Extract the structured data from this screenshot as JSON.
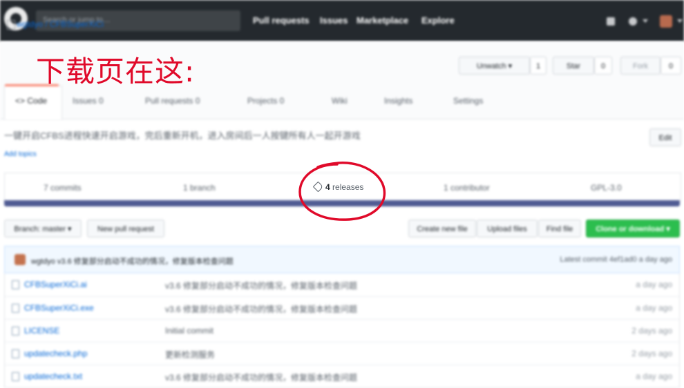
{
  "header": {
    "search_placeholder": "Search or jump to…",
    "nav": [
      "Pull requests",
      "Issues",
      "Marketplace",
      "Explore"
    ]
  },
  "repo": {
    "owner_name": "wgtdyo / CFBSuperXiCi",
    "unwatch_label": "Unwatch ▾",
    "watch_count": "1",
    "star_label": "Star",
    "star_count": "0",
    "fork_label": "Fork",
    "fork_count": "0"
  },
  "annotation": {
    "text": "下载页在这:",
    "color": "#e00a2a"
  },
  "tabs": {
    "code": "<> Code",
    "issues": "Issues 0",
    "pull_requests": "Pull requests 0",
    "projects": "Projects 0",
    "wiki": "Wiki",
    "insights": "Insights",
    "settings": "Settings"
  },
  "description": {
    "text": "一键开启CFBS进程快速开启游戏，完后重新开机，进入房间后一人按键所有人一起开游戏",
    "link": "Add topics",
    "edit_label": "Edit"
  },
  "numbers": {
    "commits": "7 commits",
    "branch": "1 branch",
    "releases_count": "4",
    "releases_word": "releases",
    "contributors": "1 contributor",
    "license": "GPL-3.0"
  },
  "file_nav": {
    "branch": "Branch: master ▾",
    "new_pr": "New pull request",
    "create": "Create new file",
    "upload": "Upload files",
    "find": "Find file",
    "clone": "Clone or download ▾"
  },
  "commit": {
    "author_message": "wgtdyo  v3.6 修复部分启动不成功的情况，修复版本检查问题",
    "latest": "Latest commit 4ef1ad0 a day ago"
  },
  "files": [
    {
      "name": "CFBSuperXiCi.ai",
      "message": "v3.6 修复部分启动不成功的情况，修复版本检查问题",
      "age": "a day ago"
    },
    {
      "name": "CFBSuperXiCi.exe",
      "message": "v3.6 修复部分启动不成功的情况，修复版本检查问题",
      "age": "a day ago"
    },
    {
      "name": "LICENSE",
      "message": "Initial commit",
      "age": "2 days ago"
    },
    {
      "name": "updatecheck.php",
      "message": "更新检测服务",
      "age": "2 days ago"
    },
    {
      "name": "updatecheck.txt",
      "message": "v3.6 修复部分启动不成功的情况，修复版本检查问题",
      "age": "a day ago"
    }
  ],
  "colors": {
    "header_bg": "#24292e",
    "link": "#0366d6",
    "clone_green": "#2cbe4e",
    "language_bar": "#4f5b93",
    "annotation_red": "#e00a2a"
  }
}
